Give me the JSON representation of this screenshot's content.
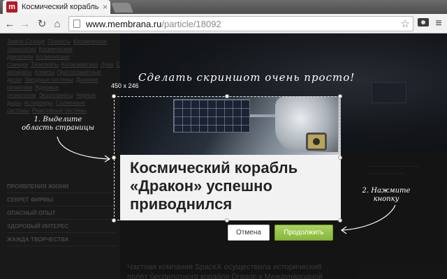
{
  "browser": {
    "tab_title": "Космический корабль «Д",
    "tab_favicon_letter": "m",
    "tab_close": "×",
    "url_host": "www.membrana.ru",
    "url_path": "/particle/18092"
  },
  "page": {
    "sidebar_links": [
      "Земля Солнце",
      "Планеты",
      "Космические технологии",
      "Космические двигатели",
      "Космические станции",
      "Телескопы",
      "Космонавтика",
      "Луна",
      "Спутники",
      "Метеориты",
      "Межзвездные аппараты",
      "Кометы",
      "Протопланетные диски",
      "Звездные системы",
      "Далекие галактики",
      "Ядерные технологии",
      "Экзопланеты",
      "Черные дыры",
      "Астероиды",
      "Солнечные системы",
      "Реактивные системы"
    ],
    "sidebar_categories": [
      "ПРОЯВЛЕНИЯ ЖИЗНИ",
      "СЕКРЕТ ФИРМЫ",
      "ОПАСНЫЙ ОПЫТ",
      "ЗДОРОВЫЙ ИНТЕРЕС",
      "ЖАЖДА ТВОРЧЕСТВА"
    ],
    "body_text": "Частная компания SpaceX осуществила исторический полёт беспилотного корабля Dragon к Международной космической станции."
  },
  "capture": {
    "instruction_title": "Сделать скриншот очень просто!",
    "dimensions": "450 x 246",
    "step1": "1. Выделите область страницы",
    "step2": "2. Нажмите кнопку",
    "headline": "Космический корабль «Дракон» успешно приводнился",
    "cancel_label": "Отмена",
    "continue_label": "Продолжить"
  },
  "colors": {
    "continue_button": "#8cc63f",
    "favicon": "#b31a24"
  }
}
